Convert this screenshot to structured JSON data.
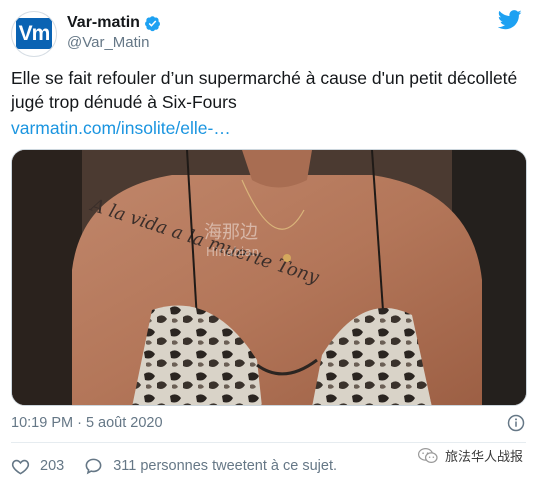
{
  "account": {
    "display_name": "Var-matin",
    "handle": "@Var_Matin",
    "avatar_text": "Vm",
    "verified": true
  },
  "tweet": {
    "text": "Elle se fait refouler d’un supermarché à cause d'un petit décolleté jugé trop dénudé à Six-Fours",
    "link": "varmatin.com/insolite/elle-…",
    "timestamp": "10:19 PM · 5 août 2020"
  },
  "media": {
    "image_text_tattoo": "A la vida a la muerte Tony",
    "image_watermark": "海那边",
    "image_watermark_latin": "Hinabian"
  },
  "actions": {
    "likes": "203",
    "comments_label": "311 personnes tweetent à ce sujet."
  },
  "footer_watermark": {
    "text": "旅法华人战报"
  },
  "colors": {
    "link": "#1b95e0",
    "twitter_blue": "#1da1f2",
    "secondary_text": "#657786",
    "brand_avatar": "#0a63b3"
  },
  "icons": {
    "verified": "verified-badge-icon",
    "twitter": "twitter-bird-icon",
    "info": "info-icon",
    "like": "heart-icon",
    "reply": "speech-bubble-icon",
    "wechat": "wechat-icon"
  }
}
